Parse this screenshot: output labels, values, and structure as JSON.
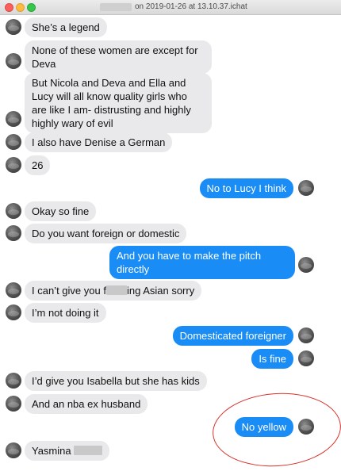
{
  "window": {
    "title": "on 2019-01-26 at 13.10.37.ichat"
  },
  "messages": [
    {
      "dir": "in",
      "text": "She’s a legend"
    },
    {
      "dir": "in",
      "text": "None of these women are except for Deva"
    },
    {
      "dir": "in",
      "text": "But Nicola and Deva and Ella and Lucy will all know quality girls who are like I am- distrusting and highly highly wary of evil"
    },
    {
      "dir": "in",
      "text": "I also have Denise a German"
    },
    {
      "dir": "in",
      "text": "26"
    },
    {
      "dir": "out",
      "text": "No to Lucy I think"
    },
    {
      "dir": "in",
      "text": "Okay so fine"
    },
    {
      "dir": "in",
      "text": "Do you want foreign or domestic"
    },
    {
      "dir": "out",
      "text": "And you have to make the pitch directly"
    },
    {
      "dir": "in",
      "text_before": "I can’t give you f",
      "text_after": "ing Asian sorry"
    },
    {
      "dir": "in",
      "text": "I’m not doing it"
    },
    {
      "dir": "out",
      "text": "Domesticated foreigner"
    },
    {
      "dir": "out",
      "text": "Is fine"
    },
    {
      "dir": "in",
      "text": "I’d give you Isabella but she has  kids"
    },
    {
      "dir": "in",
      "text": "And an nba ex husband"
    },
    {
      "dir": "out",
      "text": "No yellow"
    },
    {
      "dir": "in",
      "text": "Yasmina"
    }
  ],
  "colors": {
    "incoming_bubble": "#e9e9eb",
    "outgoing_bubble": "#1a8cf5",
    "annotation_circle": "#d9302a"
  }
}
